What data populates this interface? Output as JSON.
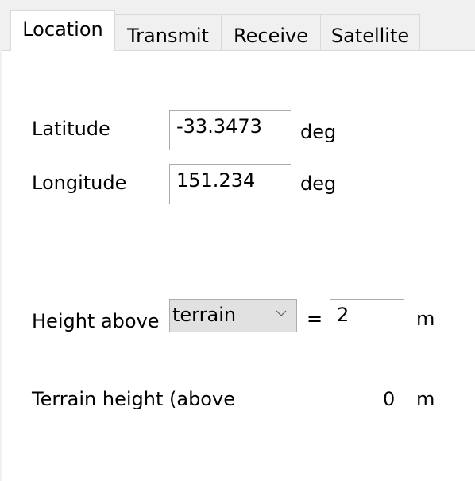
{
  "tabs": [
    {
      "label": "Location",
      "active": true
    },
    {
      "label": "Transmit",
      "active": false
    },
    {
      "label": "Receive",
      "active": false
    },
    {
      "label": "Satellite",
      "active": false
    }
  ],
  "location": {
    "latitude": {
      "label": "Latitude",
      "value": "-33.3473",
      "unit": "deg"
    },
    "longitude": {
      "label": "Longitude",
      "value": "151.234",
      "unit": "deg"
    },
    "height_above": {
      "label": "Height above",
      "reference_selected": "terrain",
      "equals": "=",
      "value": "2",
      "unit": "m"
    },
    "terrain_height": {
      "label": "Terrain height (above",
      "value": "0",
      "unit": "m"
    }
  }
}
